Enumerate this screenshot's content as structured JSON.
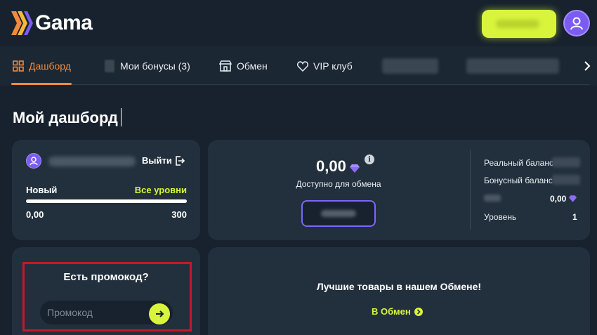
{
  "header": {
    "logo_text": "Gama",
    "icons": {
      "logo": "chevrons-logo-icon",
      "profile": "user-avatar-icon"
    }
  },
  "colors": {
    "accent": "#d9f53b",
    "active_tab": "#f28b3c",
    "purple": "#7b5cf0",
    "background": "#17222e",
    "card": "#22303d",
    "highlight_frame": "#c4182c"
  },
  "tabs": [
    {
      "label": "Дашборд",
      "icon": "dashboard-grid-icon",
      "active": true
    },
    {
      "label": "Мои бонусы (3)",
      "icon": "gift-icon",
      "active": false
    },
    {
      "label": "Обмен",
      "icon": "shop-icon",
      "active": false
    },
    {
      "label": "VIP клуб",
      "icon": "heart-icon",
      "active": false
    }
  ],
  "page": {
    "title": "Мой дашборд"
  },
  "user_card": {
    "logout_label": "Выйти",
    "level_name": "Новый",
    "all_levels_label": "Все уровни",
    "progress_min": "0,00",
    "progress_max": "300",
    "progress_fraction": 0.0
  },
  "balance_card": {
    "amount": "0,00",
    "info_glyph": "i",
    "available_label": "Доступно для обмена",
    "rows": {
      "real": "Реальный баланс",
      "bonus": "Бонусный баланс",
      "coin_value": "0,00",
      "level_label": "Уровень",
      "level_value": "1"
    }
  },
  "promo_card": {
    "title": "Есть промокод?",
    "placeholder": "Промокод"
  },
  "shop_card": {
    "title": "Лучшие товары в нашем Обмене!",
    "link_label": "В Обмен"
  }
}
